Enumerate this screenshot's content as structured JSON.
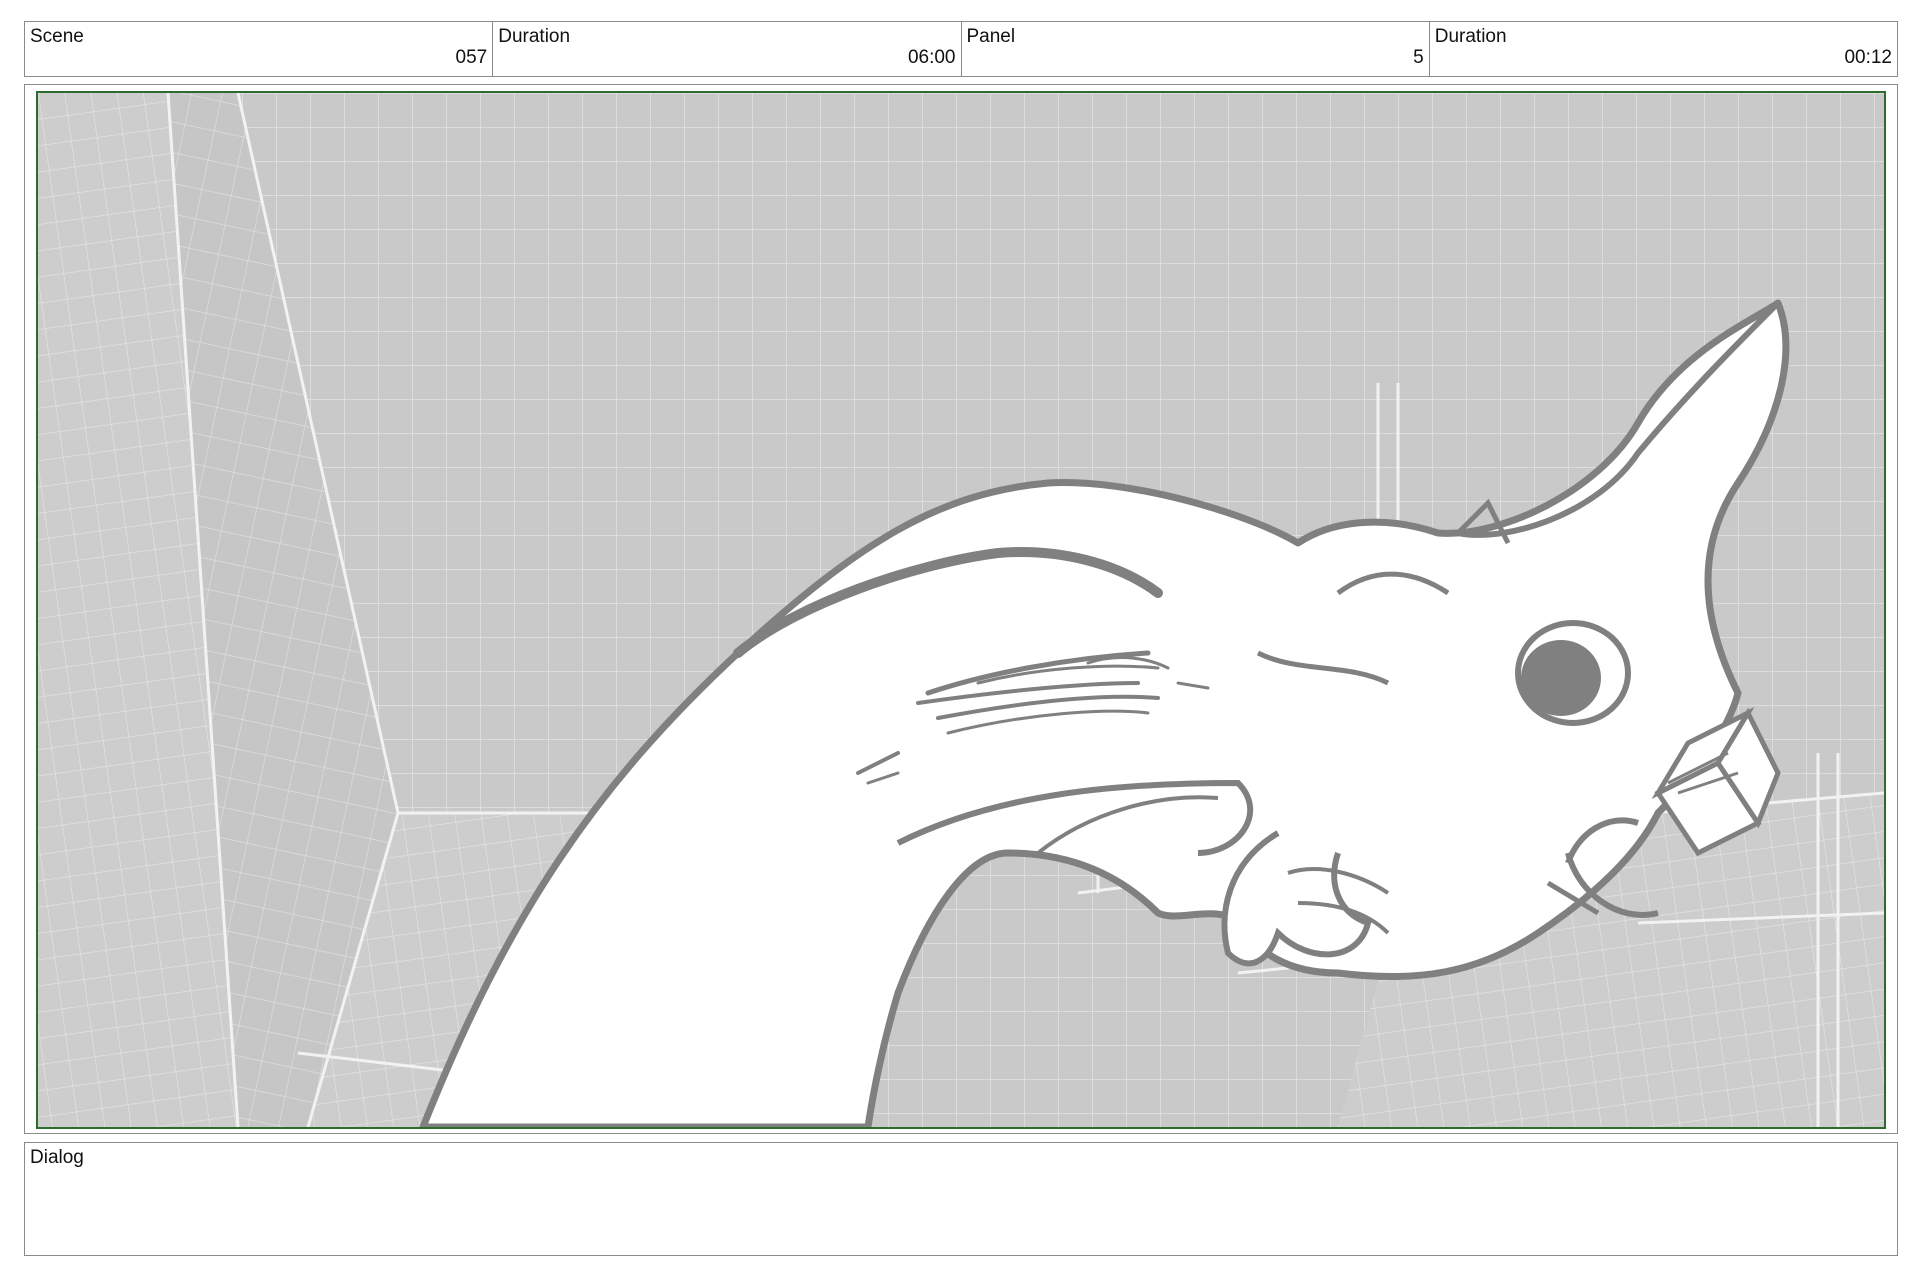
{
  "header": {
    "scene_label": "Scene",
    "scene_value": "057",
    "scene_duration_label": "Duration",
    "scene_duration_value": "06:00",
    "panel_label": "Panel",
    "panel_value": "5",
    "panel_duration_label": "Duration",
    "panel_duration_value": "00:12"
  },
  "dialog": {
    "label": "Dialog",
    "text": ""
  },
  "colors": {
    "panel_border": "#2e6b2e",
    "background_grid": "#c8c8c8",
    "character_line": "#808080",
    "frame_border": "#8a8a8a"
  }
}
